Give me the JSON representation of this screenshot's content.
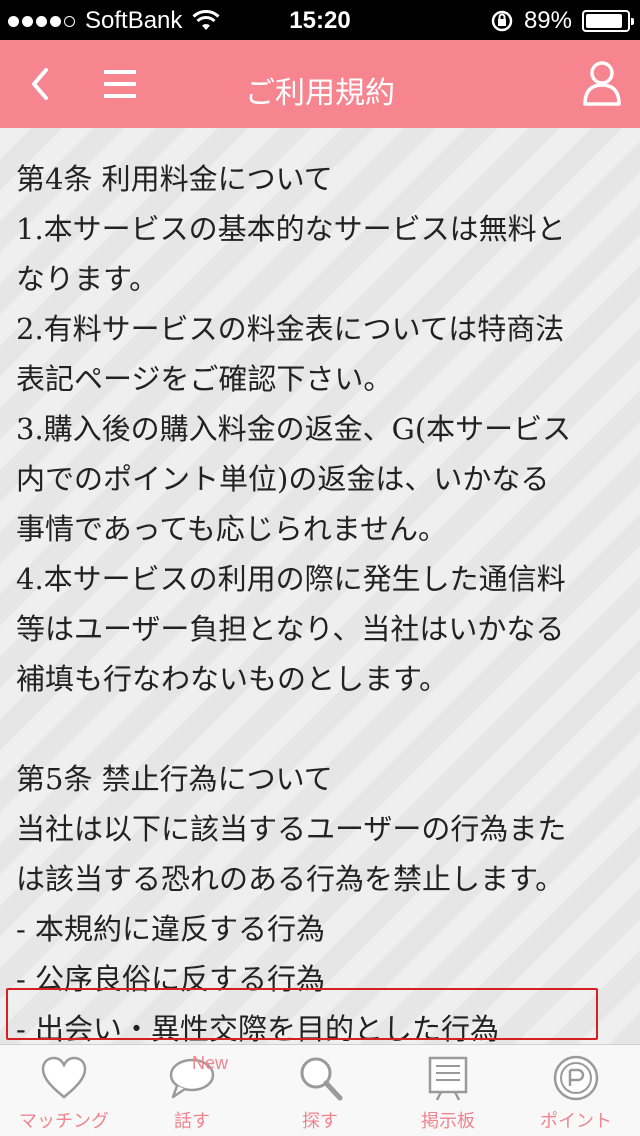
{
  "status_bar": {
    "carrier": "SoftBank",
    "time": "15:20",
    "battery_percent": "89%",
    "battery_level": 0.89
  },
  "nav": {
    "title": "ご利用規約"
  },
  "terms": {
    "article4_lines": [
      "第4条 利用料金について",
      "1.本サービスの基本的なサービスは無料と",
      "なります。",
      "2.有料サービスの料金表については特商法",
      "表記ページをご確認下さい。",
      "3.購入後の購入料金の返金、G(本サービス",
      "内でのポイント単位)の返金は、いかなる",
      "事情であっても応じられません。",
      "4.本サービスの利用の際に発生した通信料",
      "等はユーザー負担となり、当社はいかなる",
      "補填も行なわないものとします。"
    ],
    "article5_lines": [
      "第5条 禁止行為について",
      "当社は以下に該当するユーザーの行為また",
      "は該当する恐れのある行為を禁止します。",
      "- 本規約に違反する行為",
      "- 公序良俗に反する行為",
      "- 出会い・異性交際を目的とした行為"
    ]
  },
  "tabs": [
    {
      "label": "マッチング",
      "icon": "heart-icon"
    },
    {
      "label": "話す",
      "icon": "speech-bubble-icon",
      "badge": "New"
    },
    {
      "label": "探す",
      "icon": "magnifier-icon"
    },
    {
      "label": "掲示板",
      "icon": "bulletin-board-icon"
    },
    {
      "label": "ポイント",
      "icon": "coin-icon"
    }
  ],
  "colors": {
    "accent": "#f7858f",
    "highlight_border": "#d62020"
  }
}
